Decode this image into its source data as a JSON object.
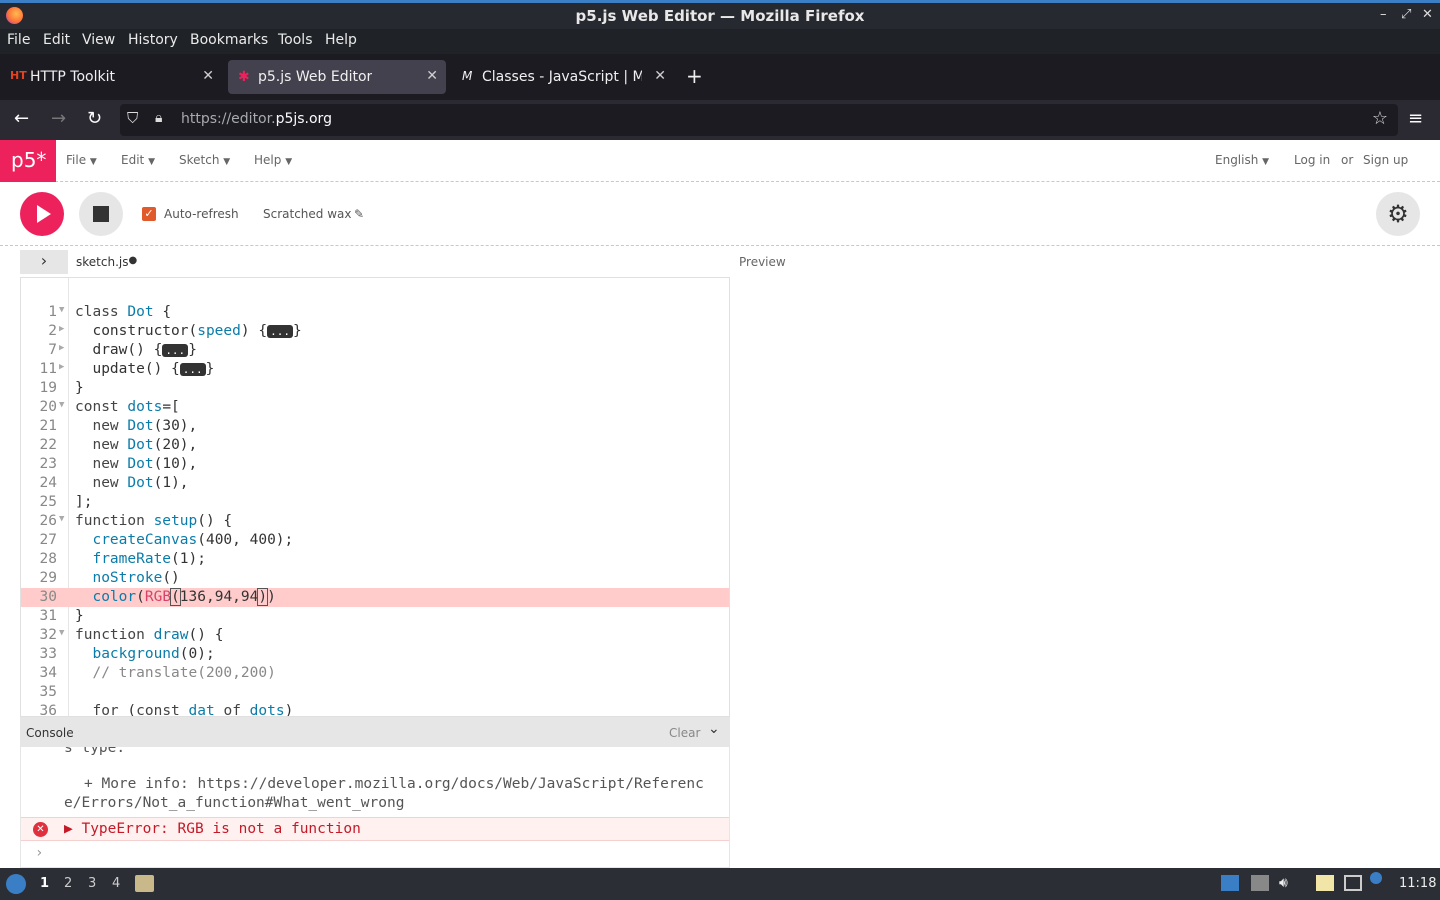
{
  "window": {
    "title": "p5.js Web Editor — Mozilla Firefox"
  },
  "menubar": [
    "File",
    "Edit",
    "View",
    "History",
    "Bookmarks",
    "Tools",
    "Help"
  ],
  "tabs": [
    {
      "icon": "HT",
      "label": "HTTP Toolkit"
    },
    {
      "icon": "✱",
      "label": "p5.js Web Editor"
    },
    {
      "icon": "M",
      "label": "Classes - JavaScript | MD"
    }
  ],
  "url": {
    "prefix": "https://editor.",
    "host": "p5js.org"
  },
  "p5": {
    "logo": "p5*",
    "menus": [
      "File",
      "Edit",
      "Sketch",
      "Help"
    ],
    "language": "English",
    "login": "Log in",
    "or": "or",
    "signup": "Sign up",
    "autorefresh": "Auto-refresh",
    "sketch_name": "Scratched wax",
    "filename": "sketch.js",
    "preview": "Preview"
  },
  "code_lines": [
    {
      "n": "1",
      "fold": "down"
    },
    {
      "n": "2",
      "fold": "right"
    },
    {
      "n": "7",
      "fold": "right"
    },
    {
      "n": "11",
      "fold": "right"
    },
    {
      "n": "19"
    },
    {
      "n": "20",
      "fold": "down"
    },
    {
      "n": "21"
    },
    {
      "n": "22"
    },
    {
      "n": "23"
    },
    {
      "n": "24"
    },
    {
      "n": "25"
    },
    {
      "n": "26",
      "fold": "down"
    },
    {
      "n": "27"
    },
    {
      "n": "28"
    },
    {
      "n": "29"
    },
    {
      "n": "30",
      "error": true
    },
    {
      "n": "31"
    },
    {
      "n": "32",
      "fold": "down"
    },
    {
      "n": "33"
    },
    {
      "n": "34"
    },
    {
      "n": "35"
    },
    {
      "n": "36"
    }
  ],
  "console": {
    "title": "Console",
    "clear": "Clear",
    "lines": [
      "s type.",
      "+ More info: https://developer.mozilla.org/docs/Web/JavaScript/Referenc",
      "e/Errors/Not_a_function#What_went_wrong"
    ],
    "error": "▶ TypeError: RGB is not a function"
  },
  "taskbar": {
    "workspaces": [
      "1",
      "2",
      "3",
      "4"
    ],
    "clock": "11:18"
  }
}
